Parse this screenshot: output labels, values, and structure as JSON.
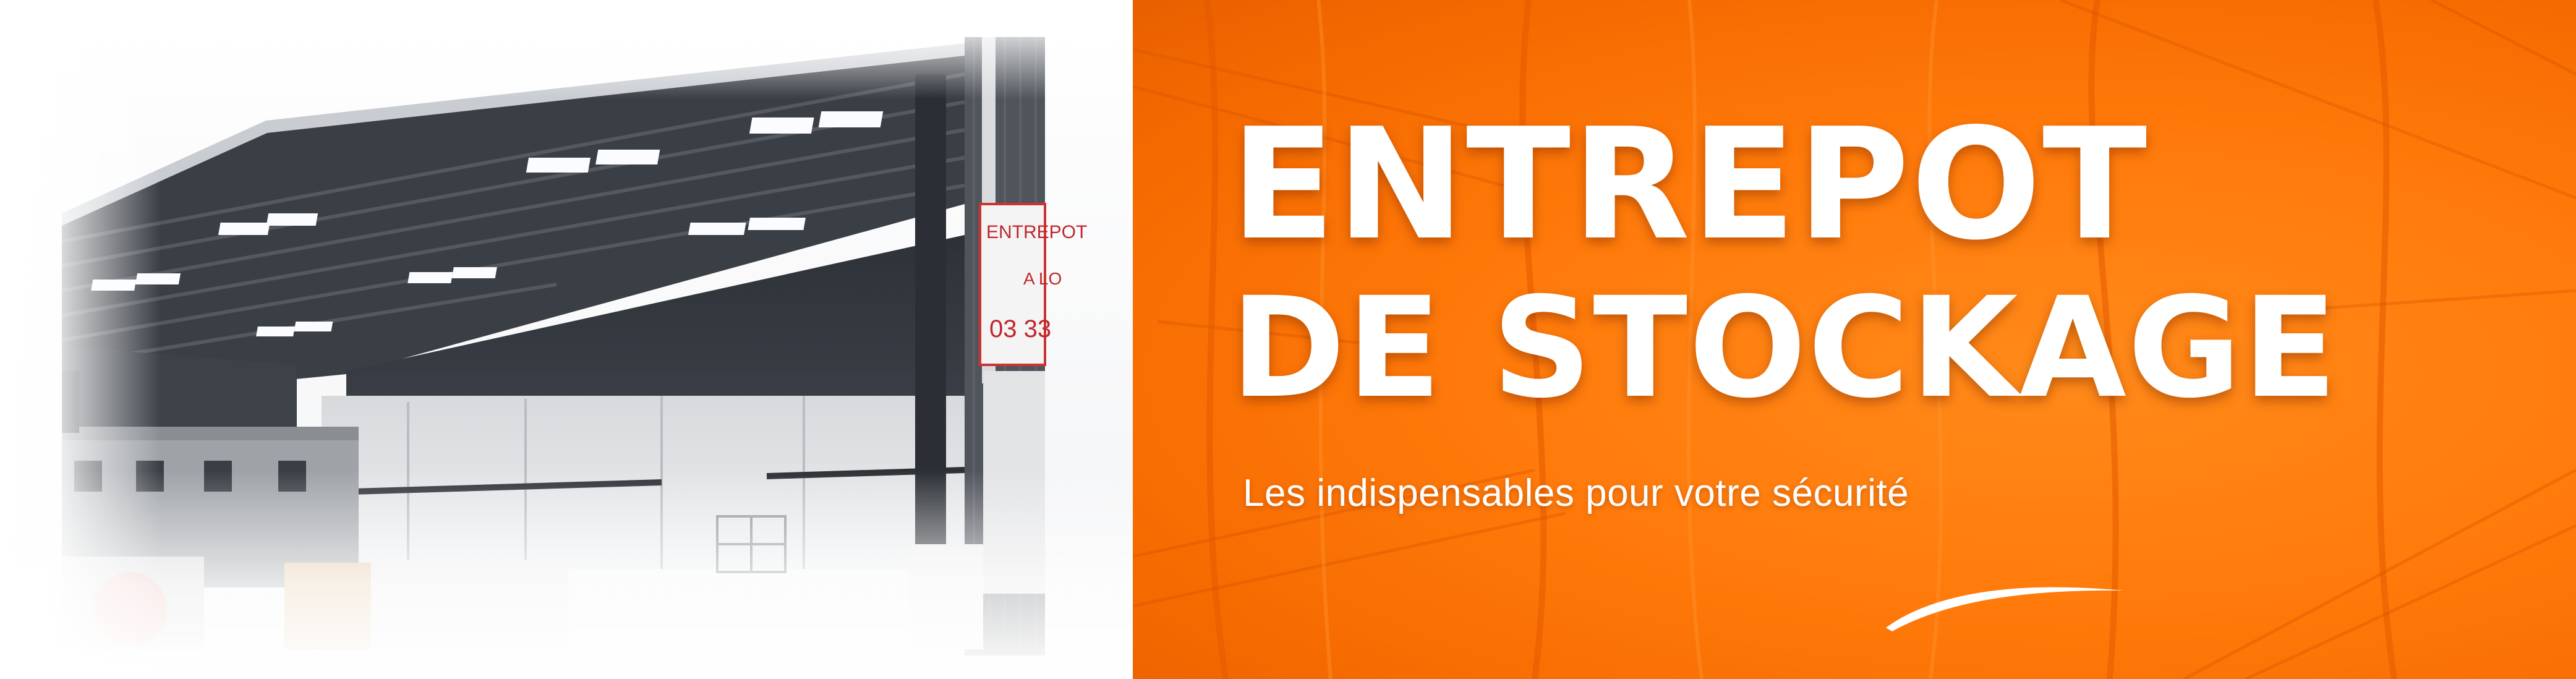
{
  "banner": {
    "headline_line1": "ENTREPOT",
    "headline_line2": "DE STOCKAGE",
    "subtitle": "Les indispensables pour votre sécurité"
  },
  "photo": {
    "sign_line1": "ENTREPOT",
    "sign_line2": "A LO",
    "sign_line3": "03 33"
  },
  "colors": {
    "accent_orange": "#ff7a0a",
    "text_white": "#ffffff"
  }
}
